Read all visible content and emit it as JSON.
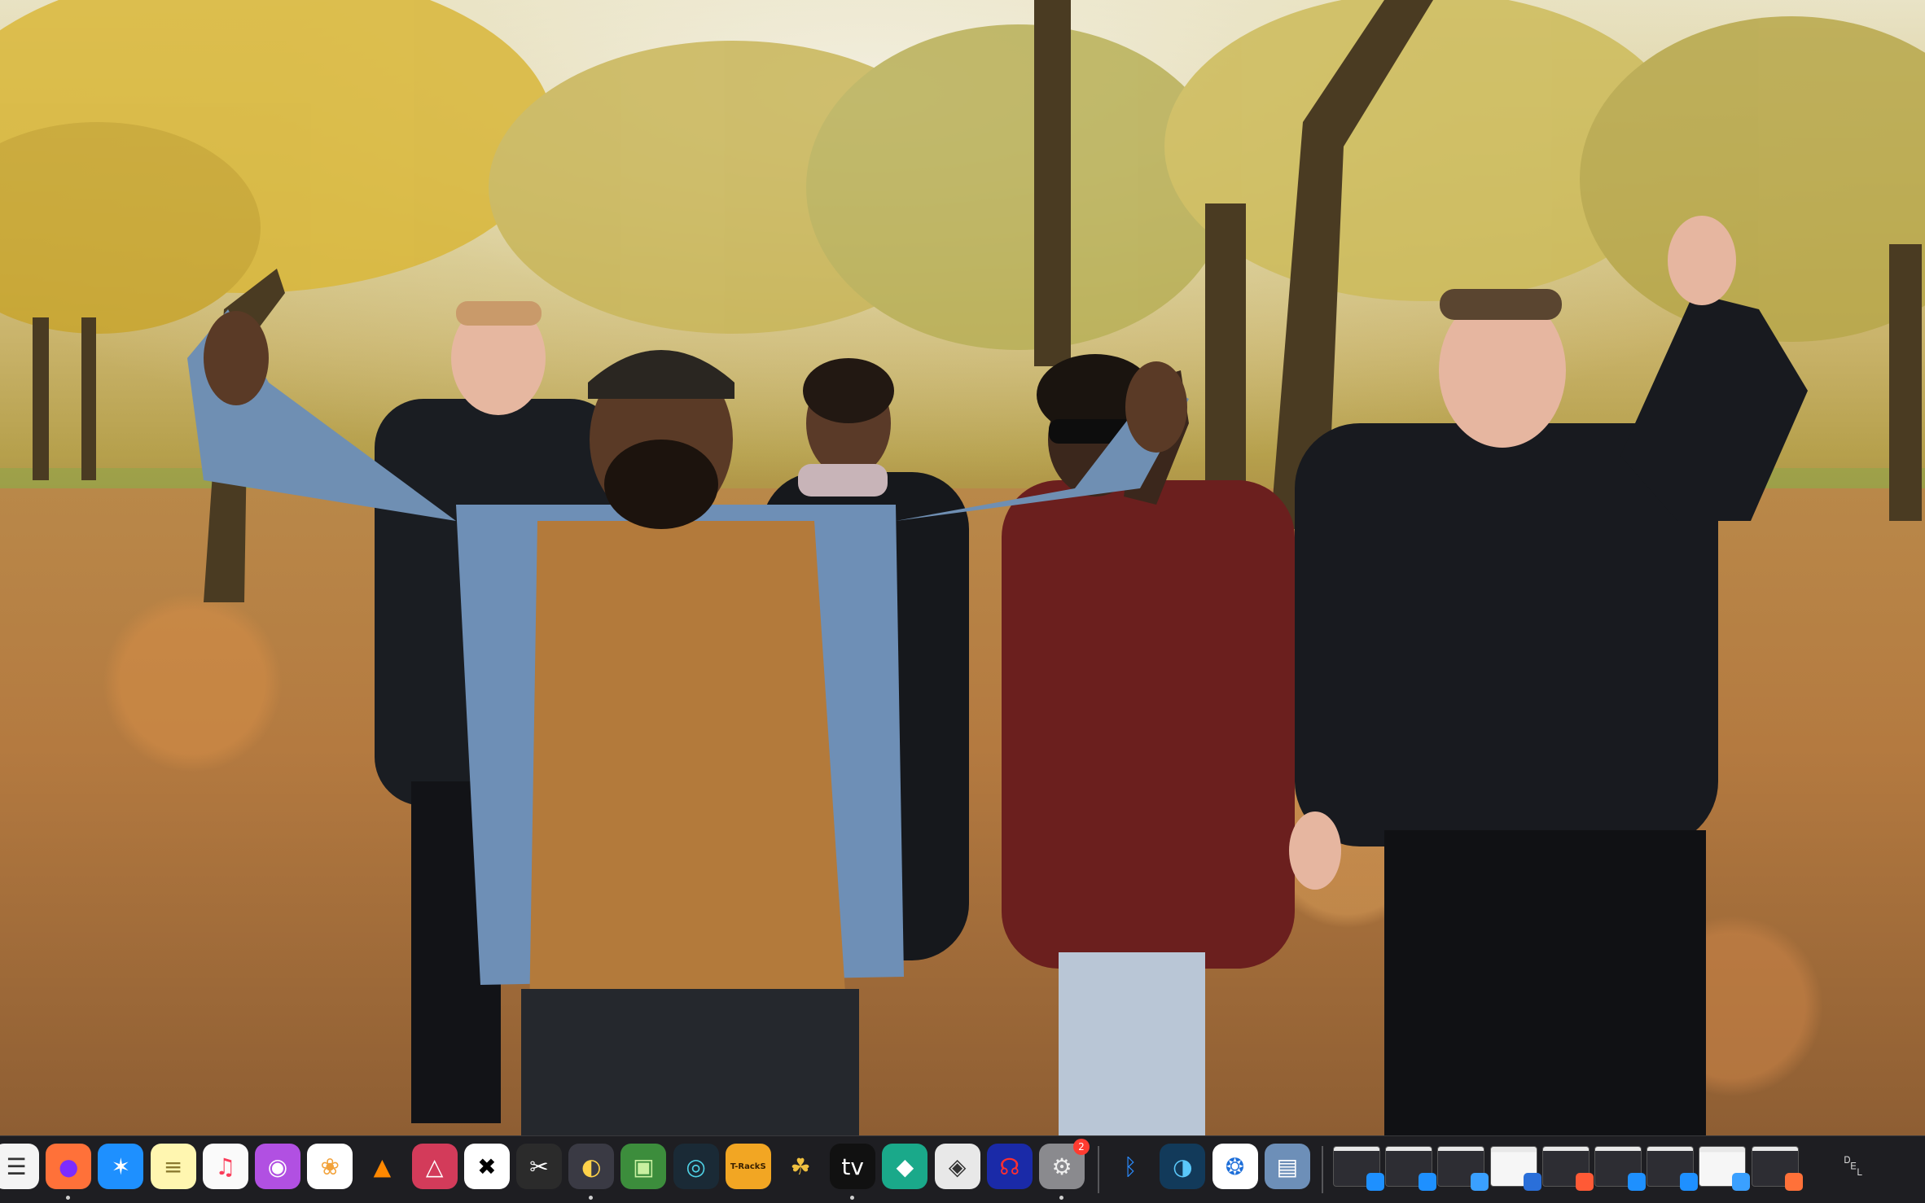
{
  "scene": {
    "description_label": ""
  },
  "dock": {
    "apps": [
      {
        "name": "textedit-icon",
        "glyph": "☰",
        "bg": "#f4f4f4",
        "fg": "#333333",
        "running": false
      },
      {
        "name": "firefox-icon",
        "glyph": "●",
        "bg": "#ff7139",
        "fg": "#7c2cff",
        "running": true
      },
      {
        "name": "network-radar-icon",
        "glyph": "✶",
        "bg": "#1e90ff",
        "fg": "#ffffff",
        "running": false
      },
      {
        "name": "notes-icon",
        "glyph": "≡",
        "bg": "#fff6b0",
        "fg": "#8a7a30",
        "running": false
      },
      {
        "name": "music-icon",
        "glyph": "♫",
        "bg": "#fafafa",
        "fg": "#fa3c5a",
        "running": false
      },
      {
        "name": "podcasts-icon",
        "glyph": "◉",
        "bg": "#b150e2",
        "fg": "#ffffff",
        "running": false
      },
      {
        "name": "photos-icon",
        "glyph": "❀",
        "bg": "#ffffff",
        "fg": "#f2a23a",
        "running": false
      },
      {
        "name": "vlc-icon",
        "glyph": "▲",
        "bg": "transparent",
        "fg": "#ff8800",
        "running": false
      },
      {
        "name": "affinity-icon",
        "glyph": "△",
        "bg": "#d33b5a",
        "fg": "#ffffff",
        "running": false
      },
      {
        "name": "capcut-icon",
        "glyph": "✖",
        "bg": "#ffffff",
        "fg": "#000000",
        "running": false
      },
      {
        "name": "final-cut-pro-icon",
        "glyph": "✂",
        "bg": "#2b2b2b",
        "fg": "#ffffff",
        "running": false
      },
      {
        "name": "davinci-resolve-icon",
        "glyph": "◐",
        "bg": "#3a3a44",
        "fg": "#ffd24a",
        "running": true
      },
      {
        "name": "cube-app-icon",
        "glyph": "▣",
        "bg": "#3c8d3c",
        "fg": "#c8f0a0",
        "running": false
      },
      {
        "name": "dial-app-icon",
        "glyph": "◎",
        "bg": "#1a2a36",
        "fg": "#4fd2e6",
        "running": false
      },
      {
        "name": "t-racks-icon",
        "glyph": "T-RackS",
        "bg": "#f2a623",
        "fg": "#3a2000",
        "running": false
      },
      {
        "name": "pineapple-icon",
        "glyph": "☘",
        "bg": "transparent",
        "fg": "#f0c040",
        "running": false
      },
      {
        "name": "apple-tv-icon",
        "glyph": "tv",
        "bg": "#111111",
        "fg": "#ffffff",
        "running": true
      },
      {
        "name": "filmora-icon",
        "glyph": "◆",
        "bg": "#1aa98a",
        "fg": "#ffffff",
        "running": false
      },
      {
        "name": "disk-utility-icon",
        "glyph": "◈",
        "bg": "#e8e8e8",
        "fg": "#333333",
        "running": false
      },
      {
        "name": "audio-app-icon",
        "glyph": "☊",
        "bg": "#1a2aa8",
        "fg": "#ff3030",
        "running": false
      },
      {
        "name": "system-settings-icon",
        "glyph": "⚙",
        "bg": "#8a8a8e",
        "fg": "#eeeeee",
        "running": true,
        "badge": "2"
      }
    ],
    "utilities": [
      {
        "name": "bluetooth-icon",
        "glyph": "ᛒ",
        "bg": "transparent",
        "fg": "#2a8cff",
        "running": false
      },
      {
        "name": "sphere-app-icon",
        "glyph": "◑",
        "bg": "#123a5a",
        "fg": "#5ac8fa",
        "running": false
      },
      {
        "name": "aperture-app-icon",
        "glyph": "❂",
        "bg": "#ffffff",
        "fg": "#1e6fd9",
        "running": false
      },
      {
        "name": "preview-icon",
        "glyph": "▤",
        "bg": "#6d8fb8",
        "fg": "#ffffff",
        "running": false
      }
    ],
    "minimized_windows": [
      {
        "name": "minimized-window-1",
        "style": "dark",
        "app_color": "#1e90ff"
      },
      {
        "name": "minimized-window-2",
        "style": "dark",
        "app_color": "#1e90ff"
      },
      {
        "name": "minimized-window-3",
        "style": "dark",
        "app_color": "#3aa0ff"
      },
      {
        "name": "minimized-window-4",
        "style": "light",
        "app_color": "#2a6fd9"
      },
      {
        "name": "minimized-window-5",
        "style": "dark",
        "app_color": "#ff5a36"
      },
      {
        "name": "minimized-window-6",
        "style": "dark",
        "app_color": "#1e90ff"
      },
      {
        "name": "minimized-window-7",
        "style": "dark",
        "app_color": "#1e90ff"
      },
      {
        "name": "minimized-window-8",
        "style": "light",
        "app_color": "#3aa0ff"
      },
      {
        "name": "minimized-window-9",
        "style": "dark",
        "app_color": "#ff7139"
      }
    ],
    "trash": {
      "name": "trash-icon",
      "glyph": "␡"
    }
  }
}
